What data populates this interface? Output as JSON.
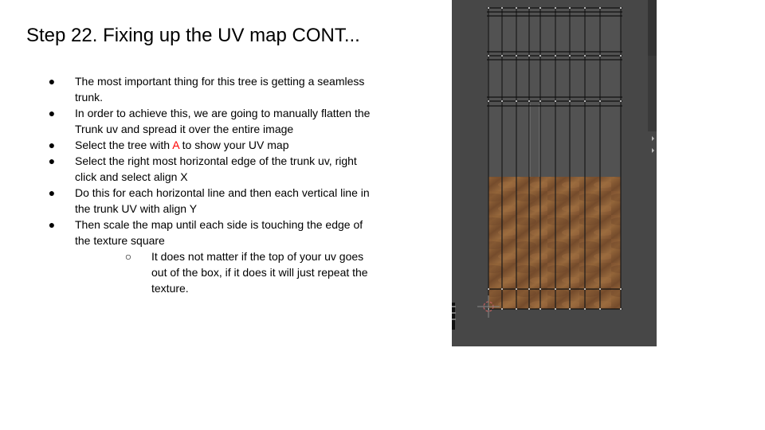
{
  "slide": {
    "title": "Step 22. Fixing up the UV map CONT...",
    "bullets": [
      {
        "text": "The most important thing for this tree is getting a seamless trunk."
      },
      {
        "text": "In order to achieve this, we are going to manually flatten the Trunk uv and spread it over the entire image"
      },
      {
        "pre": "Select the tree with ",
        "key": "A",
        "post": " to show your UV map"
      },
      {
        "text": "Select the right most horizontal edge of the trunk uv, right click and select align X"
      },
      {
        "text": "Do this for each horizontal line and then each vertical line in the trunk UV with align Y"
      },
      {
        "text": "Then scale the map until each side is touching the edge of the texture square"
      }
    ],
    "sub_bullets": [
      {
        "text": "It does not matter if the top of your uv goes out of the box, if it does it will just repeat the texture."
      }
    ],
    "bullet_glyph": "●",
    "sub_bullet_glyph": "○",
    "colors": {
      "highlight": "#ff0000",
      "editor_bg": "#474747",
      "texture": "#8a5a34"
    }
  }
}
